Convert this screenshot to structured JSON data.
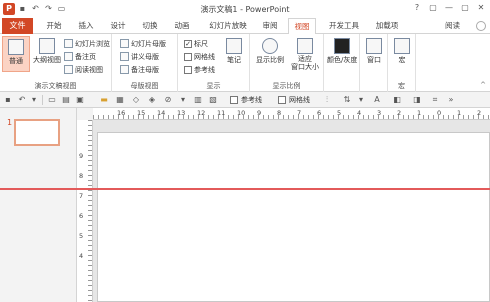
{
  "titlebar": {
    "app_icon": "P",
    "title": "演示文稿1 - PowerPoint",
    "qat_icons": [
      "save-icon",
      "undo-icon",
      "redo-icon",
      "slideshow-icon"
    ],
    "window_buttons": [
      "?",
      "▢",
      "—",
      "▢",
      "✕"
    ]
  },
  "tabs": {
    "file": "文件",
    "items": [
      "开始",
      "插入",
      "设计",
      "切换",
      "动画",
      "幻灯片放映",
      "审阅",
      "视图",
      "开发工具",
      "加载项"
    ],
    "active": "视图",
    "reader": "阅读"
  },
  "ribbon": {
    "presentation_views": {
      "label": "演示文稿视图",
      "normal": "普通",
      "outline": "大纲视图",
      "slide_sorter": "幻灯片浏览",
      "notes_page": "备注页",
      "reading_view": "阅读视图"
    },
    "master_views": {
      "label": "母版视图",
      "slide_master": "幻灯片母版",
      "handout_master": "讲义母版",
      "notes_master": "备注母版"
    },
    "show": {
      "label": "显示",
      "ruler": "标尺",
      "ruler_checked": true,
      "gridlines": "网格线",
      "guides": "参考线",
      "notes": "笔记"
    },
    "zoom": {
      "label": "显示比例",
      "zoom": "显示比例",
      "fit": "适应\n窗口大小"
    },
    "color": {
      "label": "颜色/灰度"
    },
    "window": {
      "label": "窗口"
    },
    "macros": {
      "label": "宏",
      "group_label": "宏"
    }
  },
  "toolbar2": {
    "guides_label": "参考线",
    "gridlines_label": "网格线"
  },
  "thumbs": {
    "slide_number": "1"
  },
  "hruler": {
    "labels": [
      "16",
      "15",
      "14",
      "13",
      "12",
      "11",
      "10",
      "9",
      "8",
      "7",
      "6",
      "5",
      "4",
      "3",
      "2",
      "1",
      "0",
      "1",
      "2"
    ]
  },
  "vruler": {
    "labels": [
      "9",
      "8",
      "7",
      "6",
      "5",
      "4"
    ]
  },
  "colors": {
    "accent": "#d24726",
    "guide": "#e35a5a"
  }
}
